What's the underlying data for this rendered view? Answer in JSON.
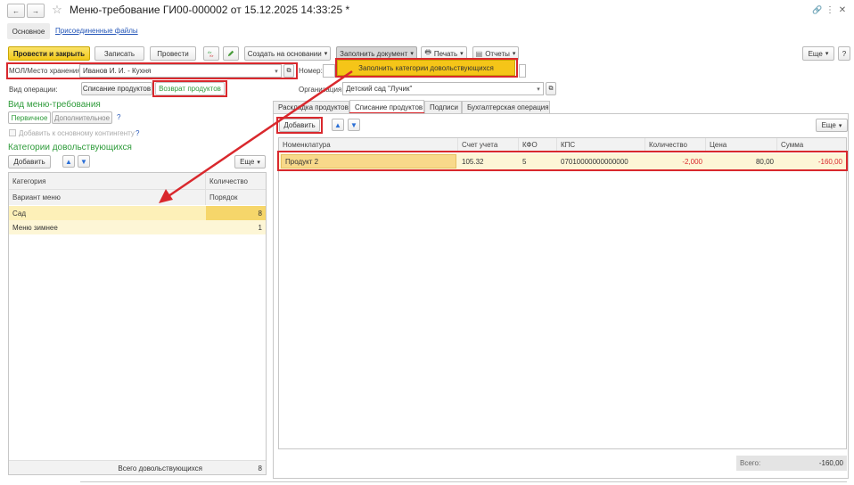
{
  "window": {
    "title": "Меню-требование ГИ00-000002 от 15.12.2025 14:33:25 *",
    "nav_back": "←",
    "nav_forward": "→",
    "star": "☆",
    "link_icon": "🔗",
    "more_icon": "⋮",
    "close_icon": "✕"
  },
  "top_tabs": {
    "main": "Основное",
    "files": "Присоединенные файлы"
  },
  "toolbar": {
    "post_close": "Провести и закрыть",
    "save": "Записать",
    "post": "Провести",
    "create_based": "Создать на основании",
    "fill_document": "Заполнить документ",
    "print": "Печать",
    "reports": "Отчеты",
    "more": "Еще",
    "help": "?",
    "fill_menu_item": "Заполнить категории довольствующихся"
  },
  "header": {
    "mol_label": "МОЛ/Место хранения:",
    "mol_value": "Иванов И. И. - Кухня",
    "number_label": "Номер:",
    "operation_label": "Вид операции:",
    "op_write_off": "Списание продуктов",
    "op_return": "Возврат продуктов",
    "org_label": "Организация:",
    "org_value": "Детский сад \"Лучик\""
  },
  "menu_type": {
    "title": "Вид меню-требования",
    "primary": "Первичное",
    "additional": "Дополнительное",
    "help": "?",
    "add_to_main": "Добавить к основному контингенту",
    "help2": "?"
  },
  "categories": {
    "title": "Категории довольствующихся",
    "add": "Добавить",
    "more": "Еще",
    "col_category": "Категория",
    "col_quantity": "Количество",
    "col_menu_variant": "Вариант меню",
    "col_order": "Порядок",
    "rows": [
      {
        "name": "Сад",
        "value": "8"
      },
      {
        "name": "Меню зимнее",
        "value": "1"
      }
    ],
    "total_label": "Всего довольствующихся",
    "total_value": "8"
  },
  "right_tabs": {
    "layout": "Раскладка продуктов",
    "write_off": "Списание продуктов",
    "signatures": "Подписи",
    "accounting": "Бухгалтерская операция"
  },
  "products": {
    "add": "Добавить",
    "more": "Еще",
    "columns": [
      "Номенклатура",
      "Счет учета",
      "КФО",
      "КПС",
      "Количество",
      "Цена",
      "Сумма"
    ],
    "rows": [
      {
        "nomenclature": "Продукт 2",
        "account": "105.32",
        "kfo": "5",
        "kps": "07010000000000000",
        "quantity": "-2,000",
        "price": "80,00",
        "sum": "-160,00"
      }
    ],
    "total_label": "Всего:",
    "total_value": "-160,00"
  },
  "colors": {
    "accent_yellow": "#f2c91a",
    "highlight_red": "#d9282d",
    "green_text": "#2e9b3a",
    "selected_row": "#fdf0b8"
  }
}
